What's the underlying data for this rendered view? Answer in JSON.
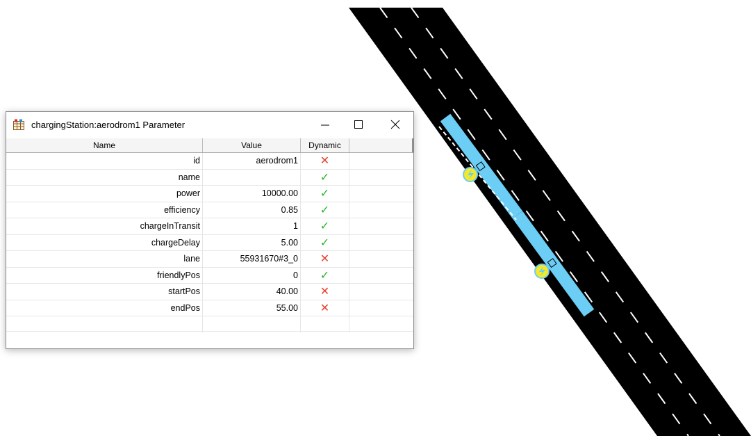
{
  "window": {
    "title": "chargingStation:aerodrom1 Parameter",
    "controls": {
      "minimize": "minimize",
      "maximize": "maximize",
      "close": "close"
    }
  },
  "table": {
    "headers": {
      "name": "Name",
      "value": "Value",
      "dynamic": "Dynamic"
    },
    "rows": [
      {
        "name": "id",
        "value": "aerodrom1",
        "dynamic": false
      },
      {
        "name": "name",
        "value": "",
        "dynamic": true
      },
      {
        "name": "power",
        "value": "10000.00",
        "dynamic": true
      },
      {
        "name": "efficiency",
        "value": "0.85",
        "dynamic": true
      },
      {
        "name": "chargeInTransit",
        "value": "1",
        "dynamic": true
      },
      {
        "name": "chargeDelay",
        "value": "5.00",
        "dynamic": true
      },
      {
        "name": "lane",
        "value": "55931670#3_0",
        "dynamic": false
      },
      {
        "name": "friendlyPos",
        "value": "0",
        "dynamic": true
      },
      {
        "name": "startPos",
        "value": "40.00",
        "dynamic": false
      },
      {
        "name": "endPos",
        "value": "55.00",
        "dynamic": false
      }
    ]
  },
  "marks": {
    "true_symbol": "✓",
    "false_symbol": "✕"
  },
  "colors": {
    "check": "#27b52a",
    "cross": "#e8412a",
    "road": "#000000",
    "lane_marking": "#ffffff",
    "charging_station": "#6ccdf5",
    "charging_icon": "#f3e82a"
  },
  "icons": {
    "app": "grid-table-icon",
    "charging": "charging-station-icon",
    "lock": "lock-icon"
  }
}
